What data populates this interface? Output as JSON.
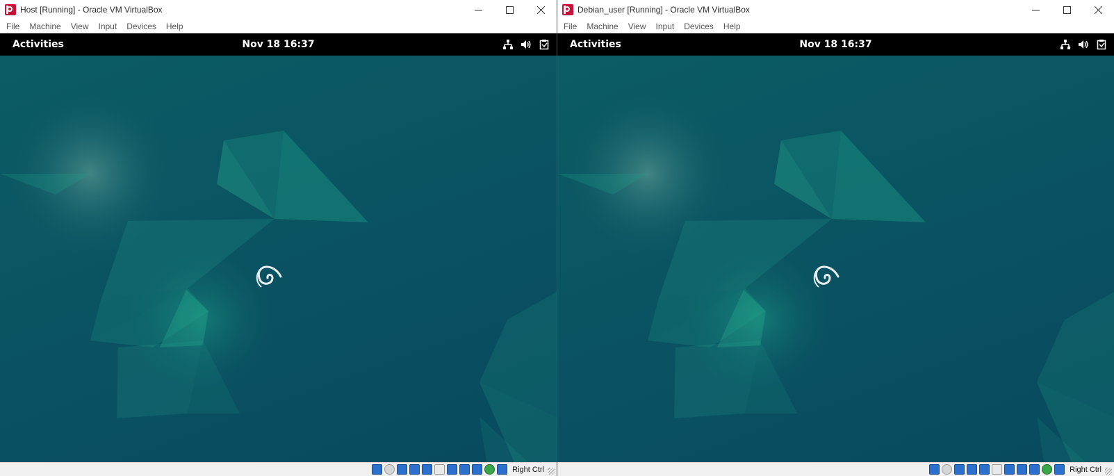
{
  "colors": {
    "gnome_topbar": "#000000",
    "wallpaper_base": "#0a5462",
    "wallpaper_accent": "#1fa38b",
    "vbox_brand": "#c4143a",
    "status_icon_blue": "#2d6fcc"
  },
  "windows": [
    {
      "title": "Host [Running] - Oracle VM VirtualBox",
      "menu": [
        "File",
        "Machine",
        "View",
        "Input",
        "Devices",
        "Help"
      ],
      "guest": {
        "activities_label": "Activities",
        "clock": "Nov 18  16:37",
        "tray_icons": [
          "network-wired-icon",
          "volume-icon",
          "clipboard-battery-icon"
        ],
        "spinner_icon": "debian-swirl-icon"
      },
      "statusbar": {
        "icons": [
          "hard-disk-icon",
          "optical-drive-icon",
          "audio-icon",
          "network-icon",
          "usb-icon",
          "shared-folder-icon",
          "display-icon",
          "video-capture-icon",
          "virtualization-icon",
          "mouse-integration-icon",
          "keyboard-capture-icon"
        ],
        "host_key": "Right Ctrl"
      }
    },
    {
      "title": "Debian_user [Running] - Oracle VM VirtualBox",
      "menu": [
        "File",
        "Machine",
        "View",
        "Input",
        "Devices",
        "Help"
      ],
      "guest": {
        "activities_label": "Activities",
        "clock": "Nov 18  16:37",
        "tray_icons": [
          "network-wired-icon",
          "volume-icon",
          "clipboard-battery-icon"
        ],
        "spinner_icon": "debian-swirl-icon"
      },
      "statusbar": {
        "icons": [
          "hard-disk-icon",
          "optical-drive-icon",
          "audio-icon",
          "network-icon",
          "usb-icon",
          "shared-folder-icon",
          "display-icon",
          "video-capture-icon",
          "virtualization-icon",
          "mouse-integration-icon",
          "keyboard-capture-icon"
        ],
        "host_key": "Right Ctrl"
      }
    }
  ]
}
